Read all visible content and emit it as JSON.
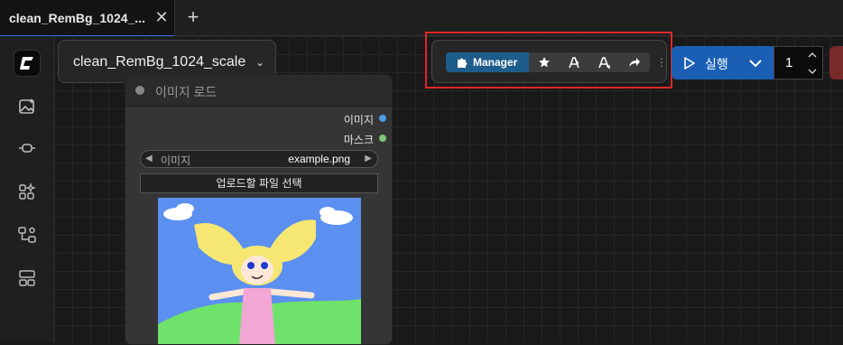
{
  "tabs": [
    {
      "label": "clean_RemBg_1024_..."
    }
  ],
  "tab_icons": {
    "close": "close-icon",
    "new": "plus-icon"
  },
  "sidebar": {
    "items": [
      {
        "icon": "logo-icon"
      },
      {
        "icon": "image-sparkle-icon"
      },
      {
        "icon": "node-library-icon"
      },
      {
        "icon": "models-icon"
      },
      {
        "icon": "workflow-icon"
      },
      {
        "icon": "templates-icon"
      }
    ]
  },
  "workflow": {
    "name": "clean_RemBg_1024_scale"
  },
  "node": {
    "title": "이미지 로드",
    "outputs": [
      {
        "label": "이미지",
        "color": "#4a9ee6"
      },
      {
        "label": "마스크",
        "color": "#7cc47a"
      }
    ],
    "widget": {
      "name": "이미지",
      "value": "example.png"
    },
    "upload_label": "업로드할 파일 선택"
  },
  "toolbar": {
    "manager_label": "Manager",
    "icons": [
      "puzzle-icon",
      "star-icon",
      "unload-models-icon",
      "free-memory-icon",
      "share-icon",
      "drag-handle-icon"
    ]
  },
  "run": {
    "label": "실행",
    "count": "1"
  },
  "colors": {
    "accent": "#1b5fb5",
    "manager": "#1e5c8c",
    "highlight": "#e0262a"
  }
}
